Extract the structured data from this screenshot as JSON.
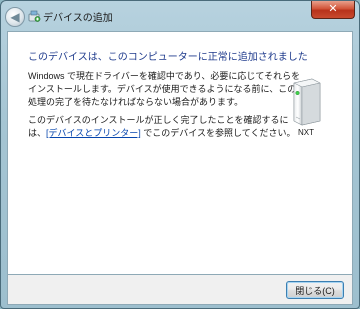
{
  "window": {
    "title": "デバイスの追加",
    "close_glyph": "✕",
    "back_glyph": "◀"
  },
  "main": {
    "heading": "このデバイスは、このコンピューターに正常に追加されました",
    "paragraph1": {
      "line1": "Windows で現在ドライバーを確認中であり、必要に応じてそれらを",
      "line2": "インストールします。デバイスが使用できるようになる前に、この",
      "line3": "処理の完了を待たなければならない場合があります。"
    },
    "paragraph2": {
      "line1": "このデバイスのインストールが正しく完了したことを確認するに",
      "line2_prefix": "は、",
      "link_text": "[デバイスとプリンター]",
      "line2_suffix": " でこのデバイスを参照してください。"
    },
    "device": {
      "label": "NXT",
      "icon": "nxt-device-icon"
    }
  },
  "footer": {
    "close_button_label": "閉じる(C)"
  },
  "colors": {
    "heading": "#1e3a8c",
    "link": "#0645ad",
    "close_red": "#c84a2e"
  }
}
